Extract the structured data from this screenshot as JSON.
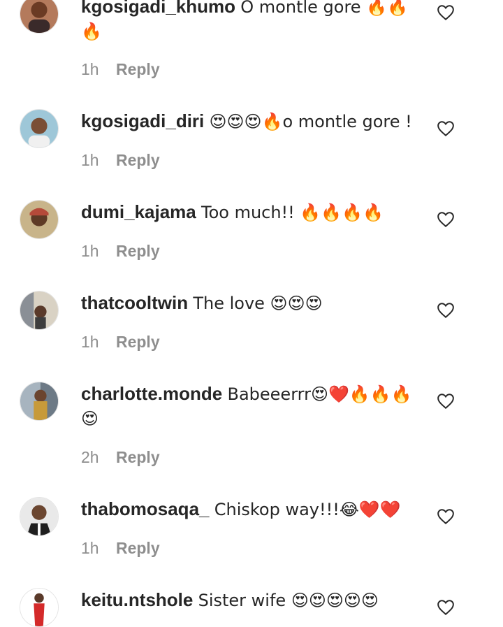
{
  "comments": [
    {
      "username": "kgosigadi_khumo",
      "text": "O montle gore 🔥🔥🔥",
      "time": "1h",
      "reply": "Reply"
    },
    {
      "username": "kgosigadi_diri",
      "text": "😍😍😍🔥o montle gore !",
      "time": "1h",
      "reply": "Reply"
    },
    {
      "username": "dumi_kajama",
      "text": "Too much!! 🔥🔥🔥🔥",
      "time": "1h",
      "reply": "Reply"
    },
    {
      "username": "thatcooltwin",
      "text": "The love 😍😍😍",
      "time": "1h",
      "reply": "Reply"
    },
    {
      "username": "charlotte.monde",
      "text": "Babeeerrr😍❤️🔥🔥🔥😍",
      "time": "2h",
      "reply": "Reply"
    },
    {
      "username": "thabomosaqa_",
      "text": "Chiskop way!!!😂❤️❤️",
      "time": "1h",
      "reply": "Reply"
    },
    {
      "username": "keitu.ntshole",
      "text": "Sister wife 😍😍😍😍😍",
      "time": "",
      "reply": ""
    }
  ],
  "icons": {
    "like": "heart-outline-icon",
    "avatar": "user-avatar"
  },
  "colors": {
    "text": "#262626",
    "meta": "#8e8e8e",
    "background": "#ffffff"
  }
}
